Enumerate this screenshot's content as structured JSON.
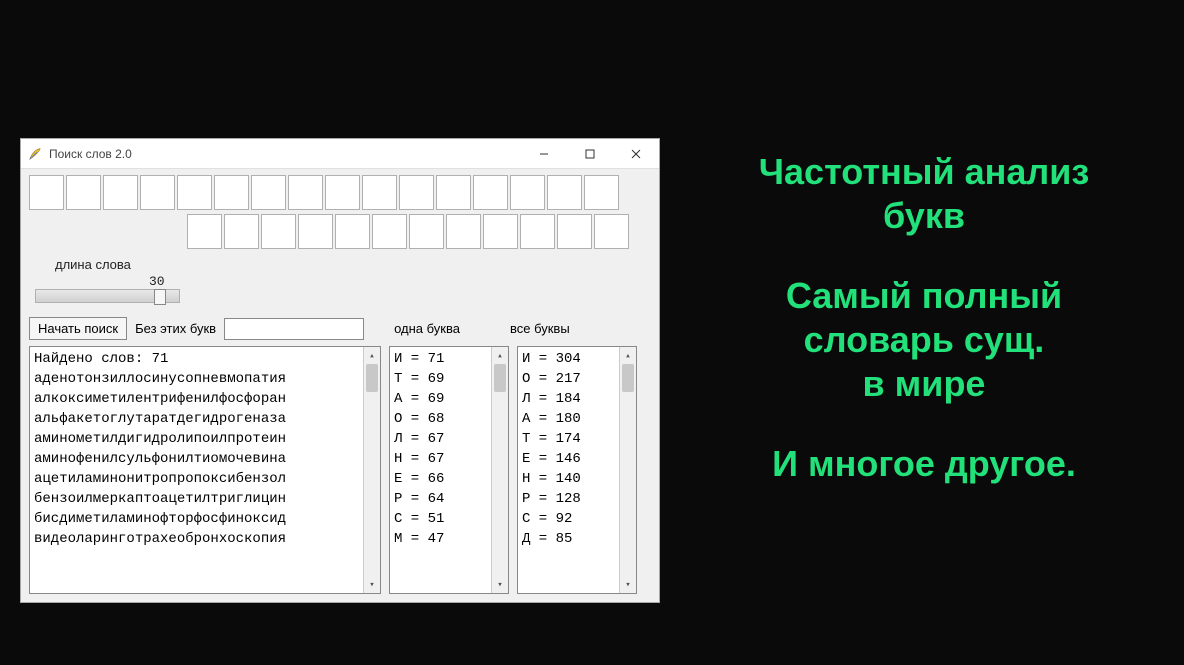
{
  "window": {
    "title": "Поиск слов 2.0"
  },
  "labels": {
    "word_length": "длина слова",
    "length_value": "30",
    "start_search": "Начать поиск",
    "without_letters": "Без этих букв",
    "one_letter": "одна буква",
    "all_letters": "все буквы"
  },
  "results": {
    "count_line": "Найдено слов: 71",
    "words": [
      "аденотонзиллосинусопневмопатия",
      "алкоксиметилентрифенилфосфоран",
      "альфакетоглутаратдегидрогеназа",
      "аминометилдигидролипоилпротеин",
      "аминофенилсульфонилтиомочевина",
      "ацетиламинонитропропоксибензол",
      "бензоилмеркаптоацетилтриглицин",
      "бисдиметиламинофторфосфиноксид",
      "видеоларинготрахеобронхоскопия"
    ]
  },
  "freq_one": [
    {
      "l": "И",
      "n": 71
    },
    {
      "l": "Т",
      "n": 69
    },
    {
      "l": "А",
      "n": 69
    },
    {
      "l": "О",
      "n": 68
    },
    {
      "l": "Л",
      "n": 67
    },
    {
      "l": "Н",
      "n": 67
    },
    {
      "l": "Е",
      "n": 66
    },
    {
      "l": "Р",
      "n": 64
    },
    {
      "l": "С",
      "n": 51
    },
    {
      "l": "М",
      "n": 47
    }
  ],
  "freq_all": [
    {
      "l": "И",
      "n": 304
    },
    {
      "l": "О",
      "n": 217
    },
    {
      "l": "Л",
      "n": 184
    },
    {
      "l": "А",
      "n": 180
    },
    {
      "l": "Т",
      "n": 174
    },
    {
      "l": "Е",
      "n": 146
    },
    {
      "l": "Н",
      "n": 140
    },
    {
      "l": "Р",
      "n": 128
    },
    {
      "l": "С",
      "n": 92
    },
    {
      "l": "Д",
      "n": 85
    }
  ],
  "promo": {
    "line1": "Частотный анализ",
    "line2": "букв",
    "line3": "Самый полный",
    "line4": "словарь сущ.",
    "line5": "в мире",
    "line6": "И многое другое."
  }
}
